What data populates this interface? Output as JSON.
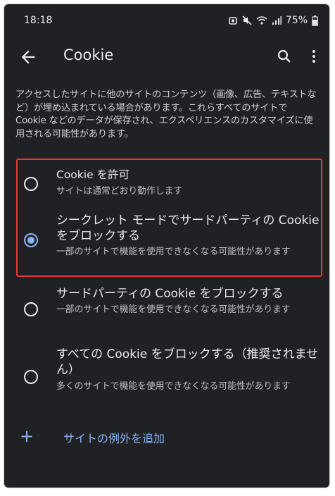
{
  "status": {
    "time": "18:18",
    "battery": "75%"
  },
  "appbar": {
    "title": "Cookie"
  },
  "description": "アクセスしたサイトに他のサイトのコンテンツ（画像、広告、テキストなど）が埋め込まれている場合があります。これらすべてのサイトで Cookie などのデータが保存され、エクスペリエンスのカスタマイズに使用される可能性があります。",
  "options": [
    {
      "title": "Cookie を許可",
      "subtitle": "サイトは通常どおり動作します",
      "selected": false
    },
    {
      "title": "シークレット モードでサードパーティの Cookie をブロックする",
      "subtitle": "一部のサイトで機能を使用できなくなる可能性があります",
      "selected": true
    },
    {
      "title": "サードパーティの Cookie をブロックする",
      "subtitle": "一部のサイトで機能を使用できなくなる可能性があります",
      "selected": false
    },
    {
      "title": "すべての Cookie をブロックする（推奨されません）",
      "subtitle": "多くのサイトで機能を使用できなくなる可能性があります",
      "selected": false
    }
  ],
  "add_exception": {
    "label": "サイトの例外を追加"
  },
  "colors": {
    "background": "#202124",
    "accent": "#8ab4f8",
    "highlight": "#e53935"
  }
}
